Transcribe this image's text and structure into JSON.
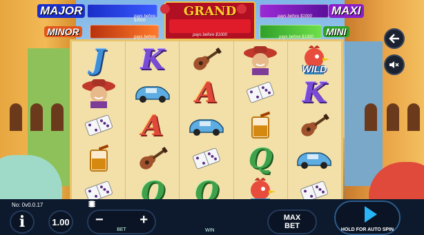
{
  "jackpots": {
    "major": {
      "label": "MAJOR",
      "note": "pays before $3000"
    },
    "minor": {
      "label": "MINOR",
      "note": "pays before $1000"
    },
    "grand": {
      "label": "GRAND",
      "note": "pays before $1000"
    },
    "maxi": {
      "label": "MAXI",
      "note": "pays before $1000"
    },
    "mini": {
      "label": "MINI",
      "note": "pays before $1000"
    }
  },
  "reels": [
    [
      "J",
      "gaucho-icon",
      "domino-icon",
      "whiskey-icon",
      "domino-icon"
    ],
    [
      "K",
      "car-icon",
      "A",
      "guitar-icon",
      "Q"
    ],
    [
      "guitar-icon",
      "A",
      "car-icon",
      "domino-icon",
      "Q"
    ],
    [
      "gaucho-icon",
      "domino-icon",
      "whiskey-icon",
      "Q",
      "rooster-icon"
    ],
    [
      "WILD",
      "K",
      "guitar-icon",
      "car-icon",
      "domino-icon"
    ]
  ],
  "wild_label": "WILD",
  "status": {
    "version": "No: 0v0.0.17"
  },
  "controls": {
    "info": "i",
    "coin_value": "1.00",
    "bet_minus": "−",
    "bet_plus": "+",
    "bet_label": "BET",
    "win_label": "WIN",
    "max_bet": "MAX BET",
    "spin_hint": "HOLD FOR AUTO SPIN"
  },
  "colors": {
    "accent": "#29b6f6",
    "grand": "#b01022",
    "major": "#1a2ec9",
    "maxi": "#8a1fc9",
    "minor": "#e0561c",
    "mini": "#2fa02a"
  }
}
